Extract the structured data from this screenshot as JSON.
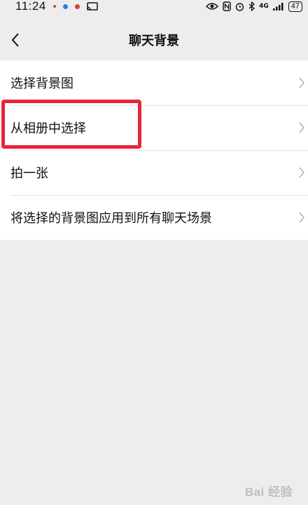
{
  "status_bar": {
    "time": "11:24",
    "network": "4G",
    "battery": "47",
    "accent_colors": [
      "#e03a3a",
      "#2b7de9",
      "#e03a3a"
    ]
  },
  "nav": {
    "title": "聊天背景",
    "back_icon": "chevron-left-icon"
  },
  "list": {
    "items": [
      {
        "label": "选择背景图"
      },
      {
        "label": "从相册中选择"
      },
      {
        "label": "拍一张"
      },
      {
        "label": "将选择的背景图应用到所有聊天场景"
      }
    ],
    "chevron_icon": "chevron-right-icon"
  },
  "highlight_color": "#e8253a",
  "watermark": "Bai 经验"
}
